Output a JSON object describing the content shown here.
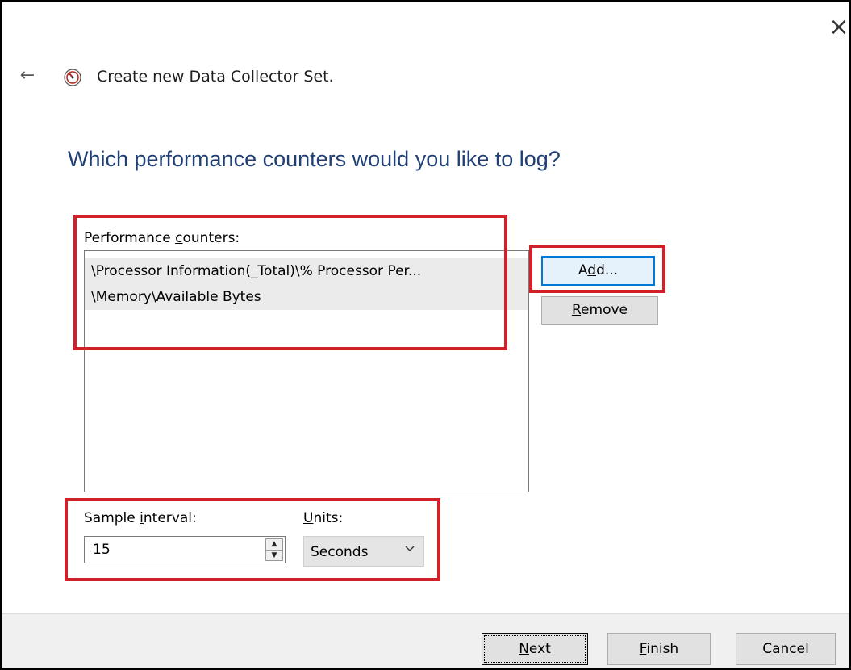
{
  "window": {
    "close_glyph": "×",
    "back_glyph": "←",
    "title": "Create new Data Collector Set.",
    "app_icon": "perfmon-icon"
  },
  "page": {
    "heading": "Which performance counters would you like to log?"
  },
  "counters": {
    "label_pre": "Performance ",
    "label_ul": "c",
    "label_post": "ounters:",
    "items": [
      "\\Processor Information(_Total)\\% Processor Per...",
      "\\Memory\\Available Bytes"
    ],
    "add_pre": "A",
    "add_ul": "d",
    "add_post": "d...",
    "remove_ul": "R",
    "remove_post": "emove"
  },
  "sample": {
    "label_pre": "Sample ",
    "label_ul": "i",
    "label_post": "nterval:",
    "value": "15",
    "units_label_ul": "U",
    "units_label_post": "nits:",
    "units_value": "Seconds"
  },
  "footer": {
    "next_ul": "N",
    "next_post": "ext",
    "finish_ul": "F",
    "finish_post": "inish",
    "cancel": "Cancel"
  },
  "colors": {
    "highlight": "#d0202a",
    "heading": "#1f3f75",
    "default_button_border": "#0078d7"
  }
}
